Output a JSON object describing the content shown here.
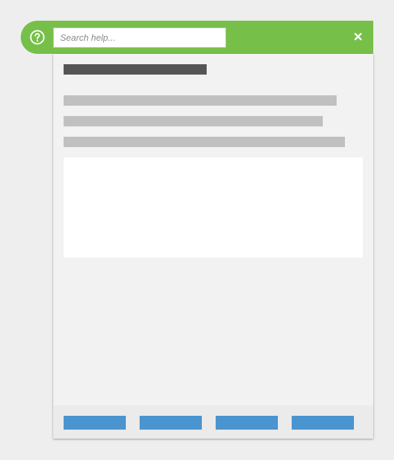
{
  "help_bar": {
    "help_icon": "question-circle-icon",
    "search_placeholder": "Search help...",
    "search_value": "",
    "close_icon": "close-x-icon"
  },
  "colors": {
    "background": "#eeeeee",
    "bar_green": "#76c04a",
    "panel": "#f2f2f2",
    "title_placeholder": "#555555",
    "text_placeholder": "#c0c0c0",
    "content_box": "#ffffff",
    "footer": "#ebebeb",
    "footer_button": "#4a94cf"
  }
}
